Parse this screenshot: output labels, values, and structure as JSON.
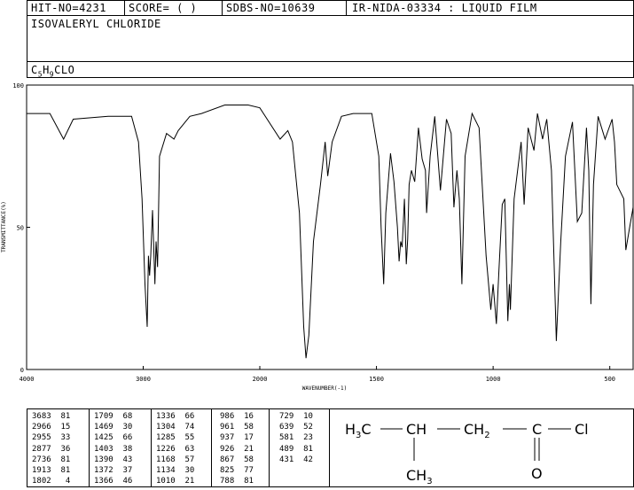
{
  "header": {
    "hit_no": "HIT-NO=4231",
    "score": "SCORE=  (  )",
    "sdbs_no": "SDBS-NO=10639",
    "ir_info": "IR-NIDA-03334 : LIQUID FILM",
    "compound_name": "ISOVALERYL CHLORIDE",
    "formula": "C5H9CLO",
    "formula_c": "C",
    "formula_c_sub": "5",
    "formula_h": "H",
    "formula_h_sub": "9",
    "formula_rest": "CLO"
  },
  "chart_data": {
    "type": "line",
    "xlabel": "WAVENUMBER(-1)",
    "ylabel": "TRANSMITTANCE(%)",
    "xlim": [
      4000,
      400
    ],
    "ylim": [
      0,
      100
    ],
    "x_ticks": [
      4000,
      3000,
      2000,
      1500,
      1000,
      500
    ],
    "y_ticks": [
      0,
      50,
      100
    ],
    "series": [
      {
        "x": [
          4000,
          3800,
          3683,
          3600,
          3300,
          3100,
          3040,
          3010,
          2985,
          2966,
          2955,
          2945,
          2935,
          2920,
          2900,
          2890,
          2877,
          2860,
          2800,
          2736,
          2700,
          2600,
          2500,
          2300,
          2100,
          2000,
          1913,
          1880,
          1860,
          1830,
          1812,
          1802,
          1790,
          1770,
          1740,
          1720,
          1709,
          1690,
          1650,
          1600,
          1520,
          1490,
          1480,
          1469,
          1460,
          1440,
          1425,
          1410,
          1403,
          1396,
          1390,
          1380,
          1372,
          1366,
          1360,
          1350,
          1336,
          1320,
          1304,
          1290,
          1285,
          1270,
          1250,
          1226,
          1200,
          1180,
          1168,
          1155,
          1145,
          1134,
          1120,
          1090,
          1060,
          1030,
          1010,
          1000,
          986,
          975,
          961,
          950,
          937,
          930,
          926,
          910,
          880,
          867,
          850,
          825,
          810,
          788,
          770,
          750,
          729,
          710,
          690,
          660,
          639,
          620,
          600,
          590,
          581,
          570,
          550,
          520,
          490,
          480,
          470,
          440,
          431,
          415,
          400
        ],
        "y": [
          90,
          90,
          81,
          88,
          89,
          89,
          80,
          60,
          30,
          15,
          40,
          33,
          40,
          56,
          30,
          45,
          36,
          75,
          83,
          81,
          84,
          89,
          90,
          93,
          93,
          92,
          81,
          84,
          80,
          55,
          15,
          4,
          12,
          45,
          65,
          80,
          68,
          80,
          89,
          90,
          90,
          75,
          50,
          30,
          55,
          76,
          66,
          50,
          38,
          45,
          43,
          60,
          37,
          46,
          65,
          70,
          66,
          85,
          74,
          70,
          55,
          75,
          89,
          63,
          88,
          83,
          57,
          70,
          60,
          30,
          75,
          90,
          85,
          40,
          21,
          30,
          16,
          35,
          58,
          60,
          17,
          30,
          21,
          60,
          80,
          58,
          85,
          77,
          90,
          81,
          88,
          70,
          10,
          45,
          75,
          87,
          52,
          55,
          85,
          70,
          23,
          65,
          89,
          81,
          88,
          80,
          65,
          60,
          42,
          50,
          57
        ]
      }
    ]
  },
  "peaks": {
    "col1": [
      "3683  81",
      "2966  15",
      "2955  33",
      "2877  36",
      "2736  81",
      "1913  81",
      "1802   4"
    ],
    "col2": [
      "1709  68",
      "1469  30",
      "1425  66",
      "1403  38",
      "1390  43",
      "1372  37",
      "1366  46"
    ],
    "col3": [
      "1336  66",
      "1304  74",
      "1285  55",
      "1226  63",
      "1168  57",
      "1134  30",
      "1010  21"
    ],
    "col4": [
      "986  16",
      "961  58",
      "937  17",
      "926  21",
      "867  58",
      "825  77",
      "788  81"
    ],
    "col5": [
      "729  10",
      "639  52",
      "581  23",
      "489  81",
      "431  42"
    ]
  },
  "structure": {
    "h3c": "H3C",
    "h3c_h": "H",
    "h3c_sub": "3",
    "h3c_c": "C",
    "ch": "CH",
    "ch2": "CH2",
    "ch2_c": "CH",
    "ch2_sub": "2",
    "c": "C",
    "cl": "Cl",
    "ch3": "CH3",
    "ch3_c": "CH",
    "ch3_sub": "3",
    "o": "O"
  }
}
